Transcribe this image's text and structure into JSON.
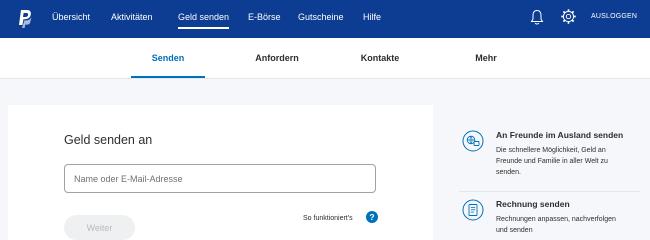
{
  "colors": {
    "header_bg": "#0d3d93",
    "accent": "#0070ba",
    "page_bg": "#f5f7fa"
  },
  "header": {
    "logo_icon": "paypal-logo",
    "nav": [
      {
        "label": "Übersicht"
      },
      {
        "label": "Aktivitäten"
      },
      {
        "label": "Geld senden",
        "active": true
      },
      {
        "label": "E-Börse"
      },
      {
        "label": "Gutscheine"
      },
      {
        "label": "Hilfe"
      }
    ],
    "notifications_icon": "bell-icon",
    "settings_icon": "gear-icon",
    "logout_label": "AUSLOGGEN"
  },
  "subnav": {
    "tabs": [
      {
        "label": "Senden",
        "active": true
      },
      {
        "label": "Anfordern"
      },
      {
        "label": "Kontakte"
      },
      {
        "label": "Mehr"
      }
    ]
  },
  "main": {
    "title": "Geld senden an",
    "recipient_placeholder": "Name oder E-Mail-Adresse",
    "recipient_value": "",
    "next_button": "Weiter",
    "help_link": "So funktioniert's",
    "help_icon": "question-mark-icon"
  },
  "sidebar": {
    "items": [
      {
        "icon": "globe-transfer-icon",
        "title": "An Freunde im Ausland senden",
        "desc_lines": [
          "Die schnellere Möglichkeit, Geld an",
          "Freunde und Familie in aller Welt zu",
          "senden."
        ]
      },
      {
        "icon": "invoice-icon",
        "title": "Rechnung senden",
        "desc_lines": [
          "Rechnungen anpassen, nachverfolgen",
          "und senden"
        ]
      }
    ]
  }
}
